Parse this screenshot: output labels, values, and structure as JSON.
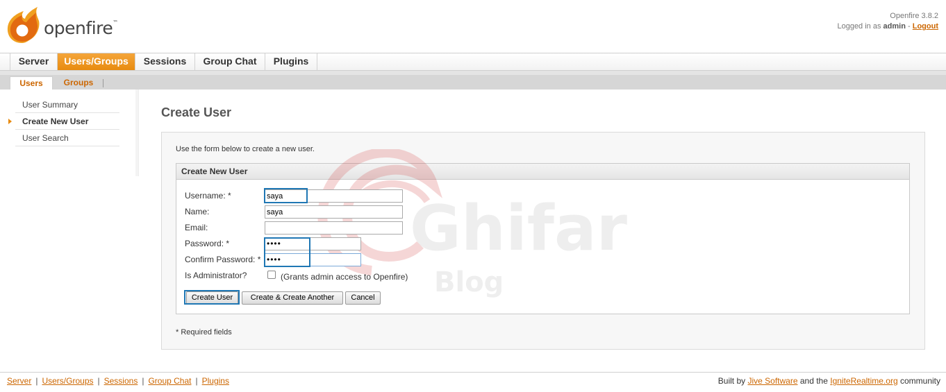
{
  "header": {
    "logo_text": "openfire",
    "logo_tm": "™",
    "version": "Openfire 3.8.2",
    "logged_in_prefix": "Logged in as",
    "user": "admin",
    "separator": "-",
    "logout": "Logout"
  },
  "main_tabs": [
    "Server",
    "Users/Groups",
    "Sessions",
    "Group Chat",
    "Plugins"
  ],
  "active_main_tab": "Users/Groups",
  "sub_tabs": [
    "Users",
    "Groups"
  ],
  "active_sub_tab": "Users",
  "sidebar": {
    "items": [
      "User Summary",
      "Create New User",
      "User Search"
    ],
    "active": "Create New User"
  },
  "page": {
    "title": "Create User",
    "intro": "Use the form below to create a new user.",
    "form_title": "Create New User",
    "required_note": "* Required fields"
  },
  "form": {
    "username_label": "Username: *",
    "username_value": "saya",
    "name_label": "Name:",
    "name_value": "saya",
    "email_label": "Email:",
    "email_value": "",
    "password_label": "Password: *",
    "password_value": "••••",
    "confirm_label": "Confirm Password: *",
    "confirm_value": "••••",
    "admin_label": "Is Administrator?",
    "admin_checked": false,
    "admin_note": "(Grants admin access to Openfire)"
  },
  "buttons": {
    "create": "Create User",
    "create_another": "Create & Create Another",
    "cancel": "Cancel"
  },
  "footer": {
    "links": [
      "Server",
      "Users/Groups",
      "Sessions",
      "Group Chat",
      "Plugins"
    ],
    "link_sep": "|",
    "built_by": "Built by",
    "jive": "Jive Software",
    "and_the": "and the",
    "ignite": "IgniteRealtime.org",
    "community": "community"
  },
  "watermark": {
    "text_main": "Ghifar",
    "text_sub": "Blog"
  },
  "colors": {
    "accent": "#e88b10",
    "link": "#cc6600",
    "highlight": "#1f77b4"
  }
}
